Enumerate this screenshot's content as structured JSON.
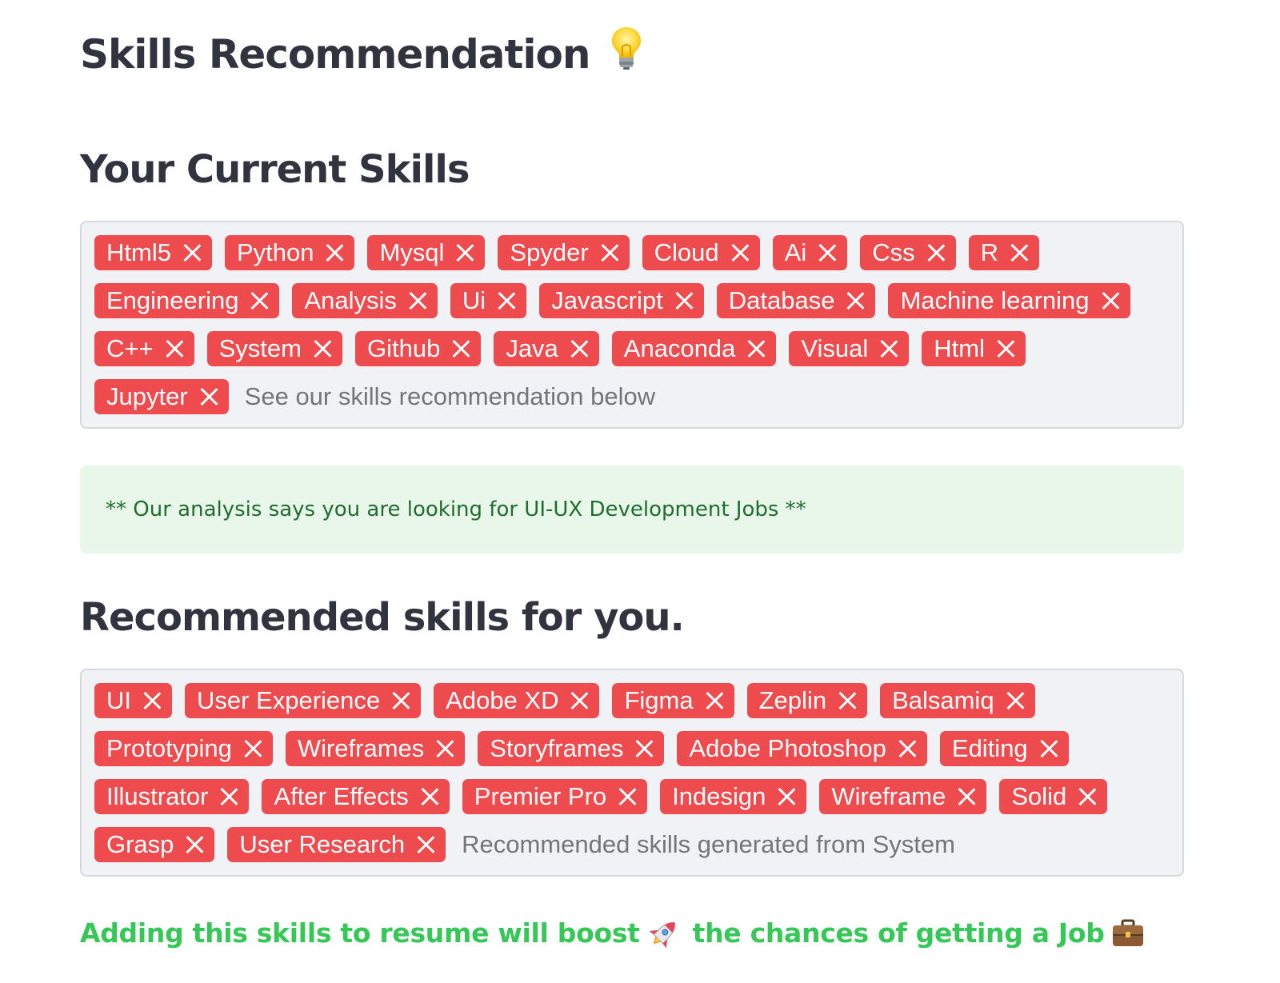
{
  "page_title": "Skills Recommendation",
  "current_skills": {
    "heading": "Your Current Skills",
    "tags": [
      "Html5",
      "Python",
      "Mysql",
      "Spyder",
      "Cloud",
      "Ai",
      "Css",
      "R",
      "Engineering",
      "Analysis",
      "Ui",
      "Javascript",
      "Database",
      "Machine learning",
      "C++",
      "System",
      "Github",
      "Java",
      "Anaconda",
      "Visual",
      "Html",
      "Jupyter"
    ],
    "input_placeholder": "See our skills recommendation below"
  },
  "analysis_message": "** Our analysis says you are looking for UI-UX Development Jobs **",
  "recommended_skills": {
    "heading": "Recommended skills for you.",
    "tags": [
      "UI",
      "User Experience",
      "Adobe XD",
      "Figma",
      "Zeplin",
      "Balsamiq",
      "Prototyping",
      "Wireframes",
      "Storyframes",
      "Adobe Photoshop",
      "Editing",
      "Illustrator",
      "After Effects",
      "Premier Pro",
      "Indesign",
      "Wireframe",
      "Solid",
      "Grasp",
      "User Research"
    ],
    "input_placeholder": "Recommended skills generated from System"
  },
  "boost_message": {
    "part1": "Adding this skills to resume will boost",
    "part2": "the chances of getting a Job"
  },
  "icons": {
    "title_icon": "lightbulb-icon",
    "boost_icon": "rocket-icon",
    "job_icon": "briefcase-icon",
    "tag_remove_icon": "close-icon"
  },
  "colors": {
    "tag_background": "#ee4b4f",
    "success_background": "#e9f6ea",
    "success_text": "#1e6e2e",
    "boost_text": "#36c857"
  }
}
